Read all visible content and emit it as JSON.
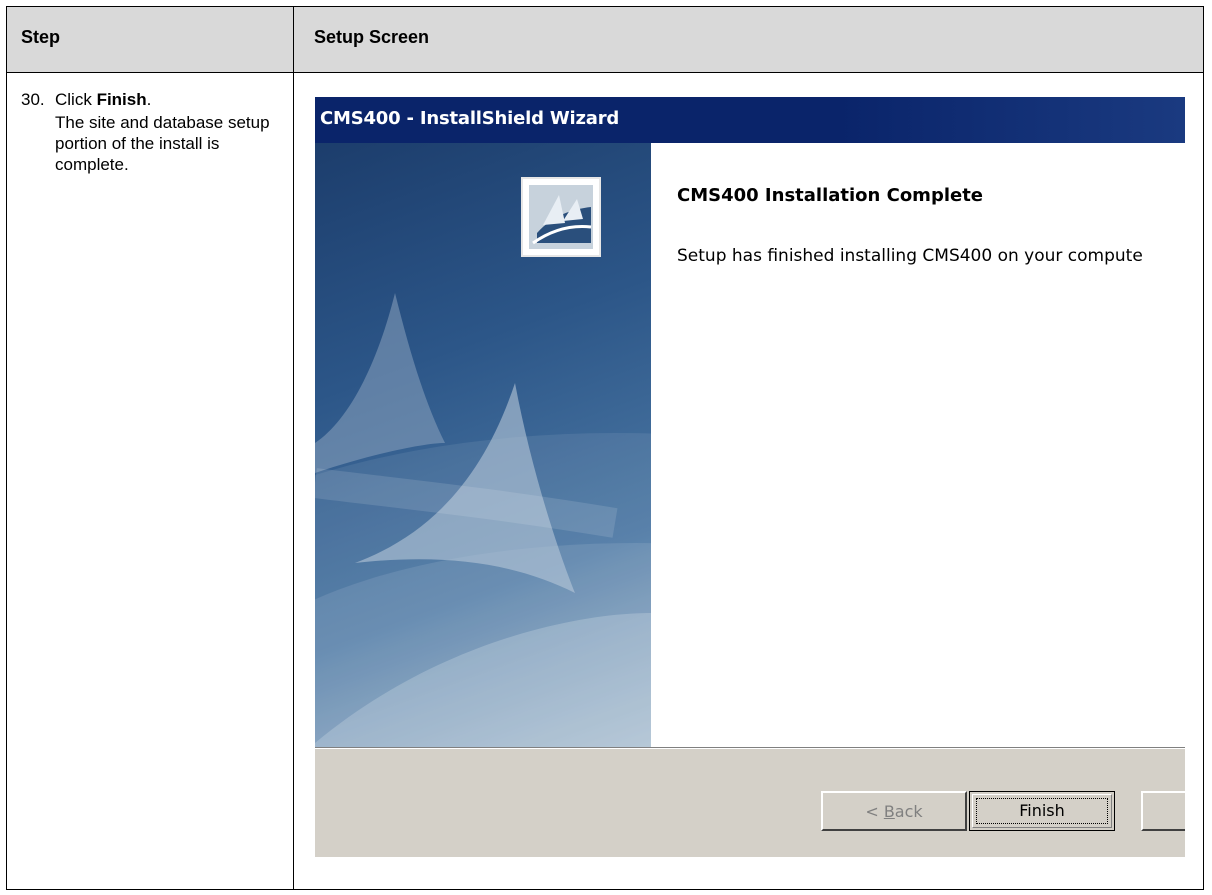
{
  "table": {
    "header": {
      "step": "Step",
      "setup_screen": "Setup Screen"
    },
    "row": {
      "step_number": "30.",
      "step_action_prefix": "Click ",
      "step_action_bold": "Finish",
      "step_action_suffix": ".",
      "step_description": "The site and database setup portion of the install is complete."
    }
  },
  "wizard": {
    "title": "CMS400 - InstallShield Wizard",
    "heading": "CMS400 Installation Complete",
    "message": "Setup has finished installing CMS400 on your compute",
    "buttons": {
      "back_prefix": "< ",
      "back_underlined": "B",
      "back_rest": "ack",
      "finish": "Finish",
      "cancel": "("
    }
  },
  "colors": {
    "title_bar": "#0a246a",
    "dialog_bg": "#d4d0c8",
    "table_header_bg": "#d9d9d9"
  }
}
